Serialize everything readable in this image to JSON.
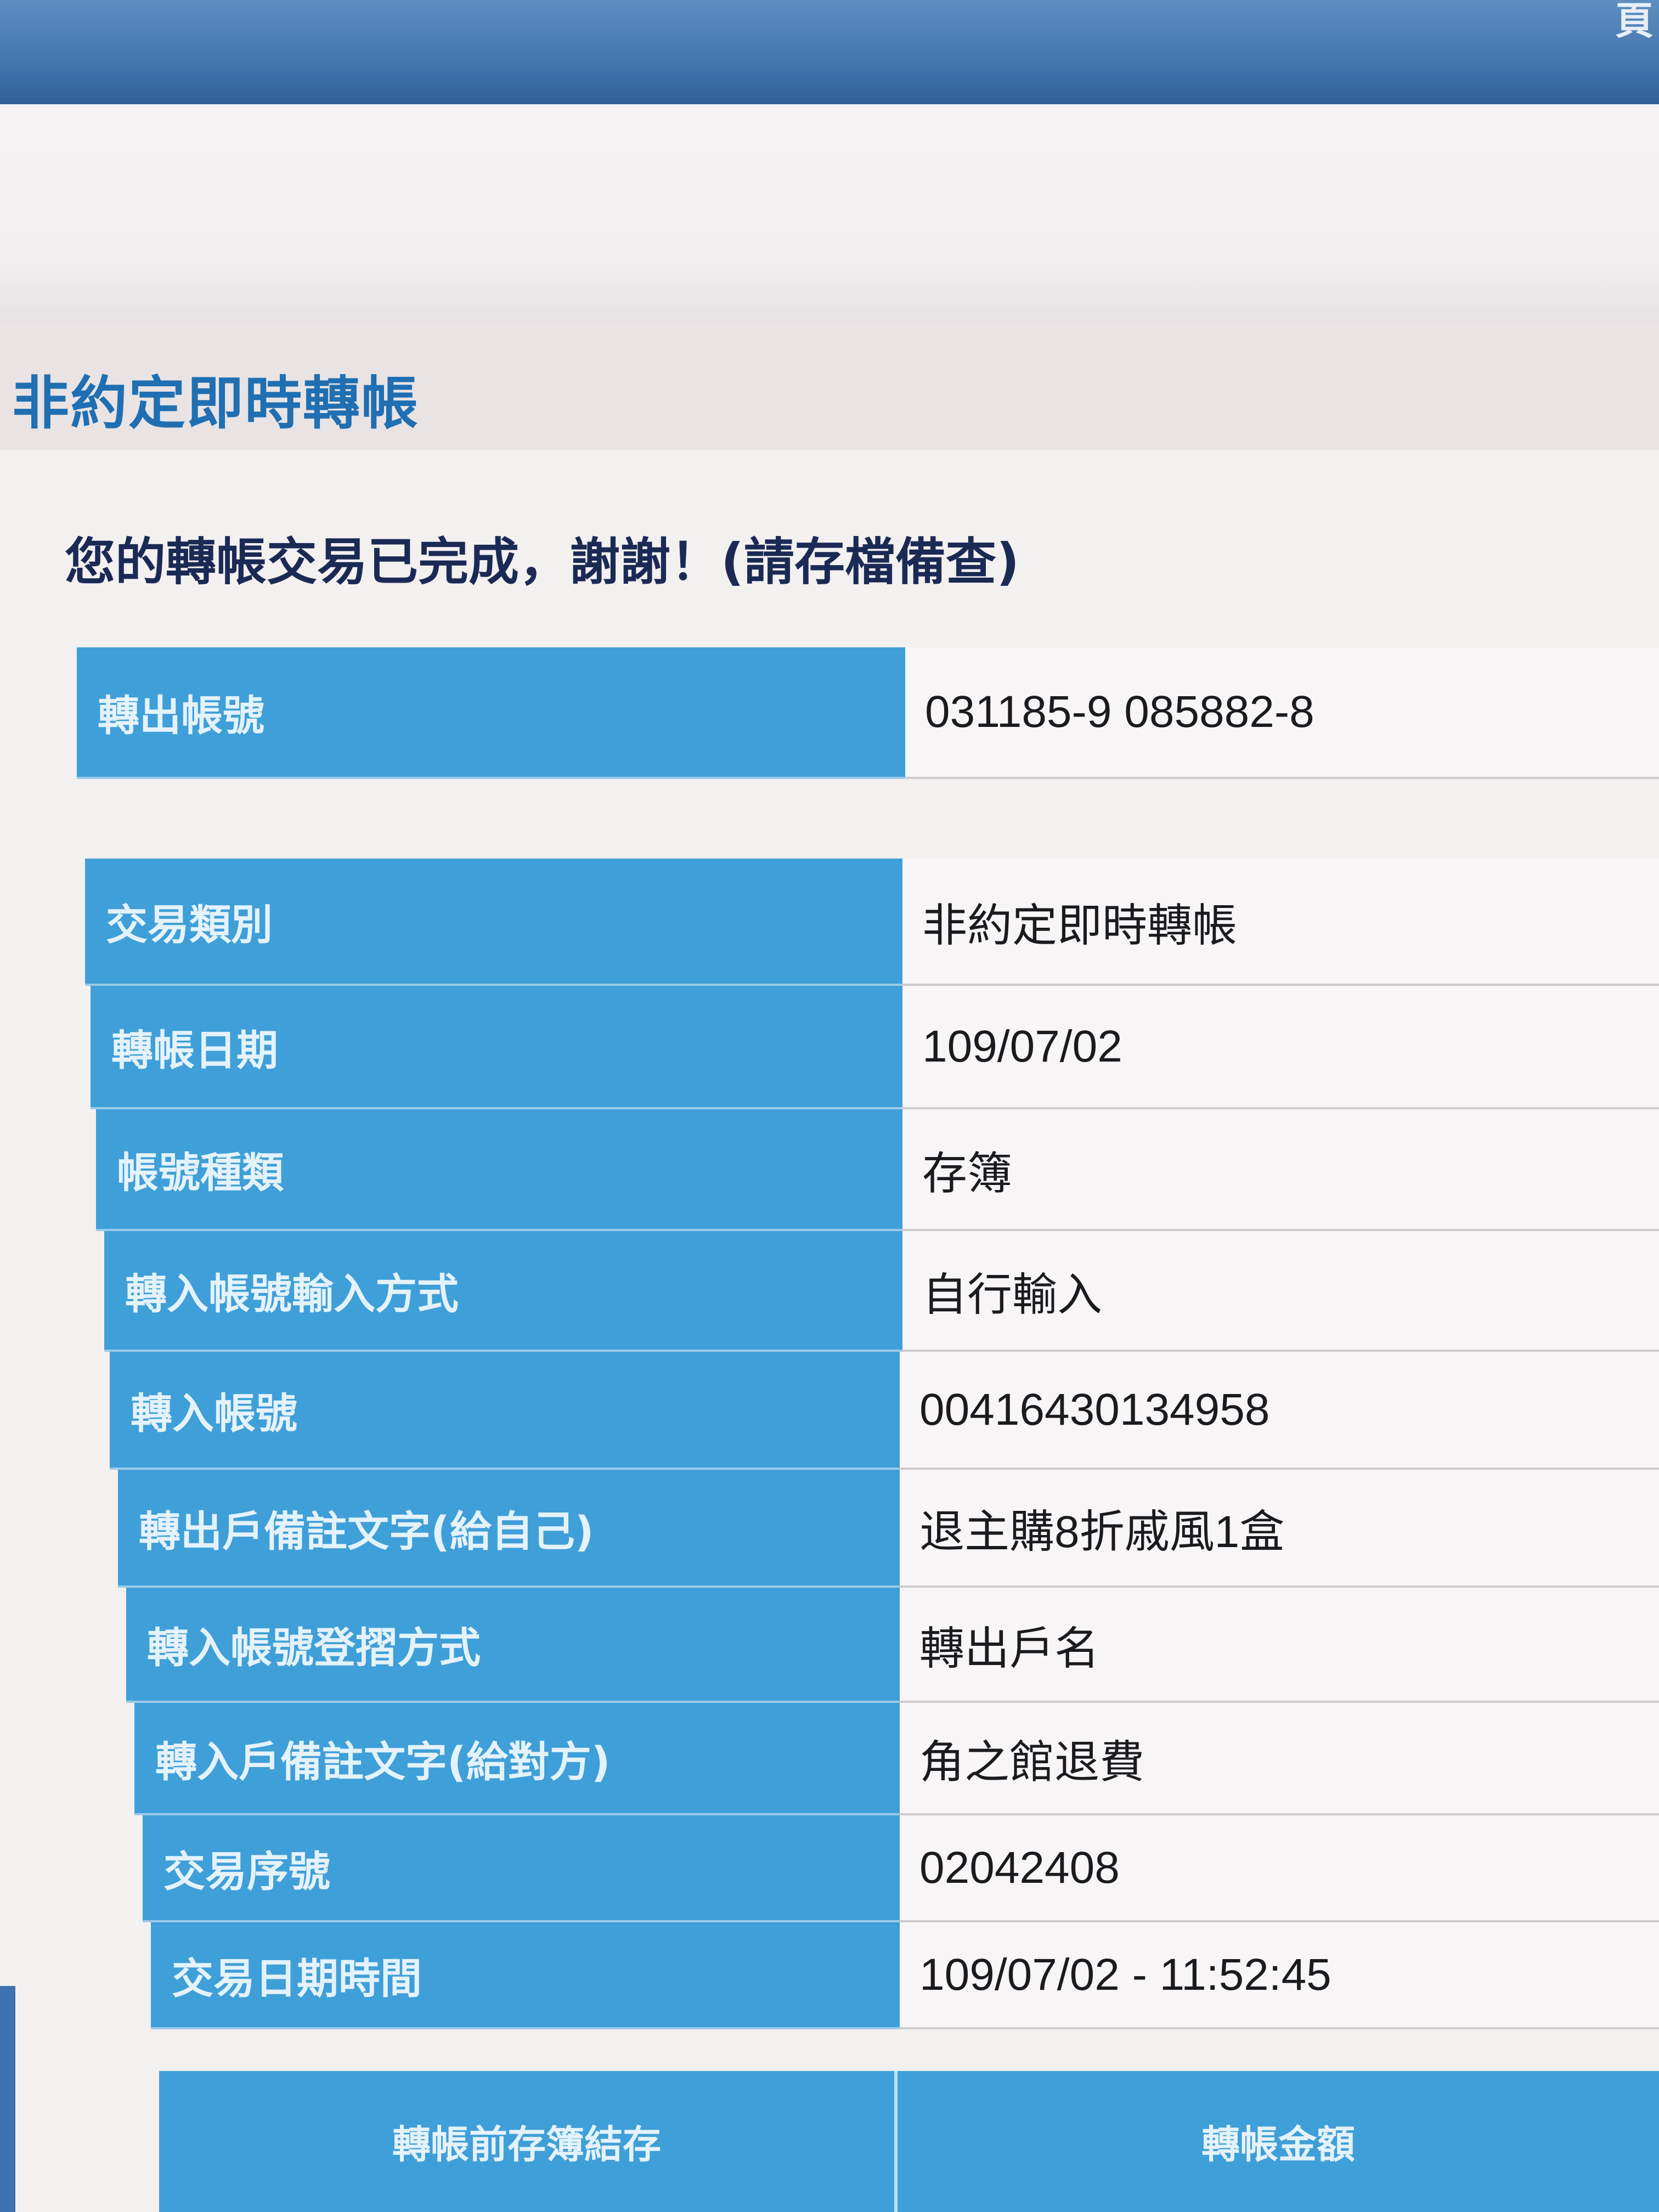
{
  "top_bar": {
    "corner_text": "頁"
  },
  "page_title": "非約定即時轉帳",
  "success_message": "您的轉帳交易已完成，謝謝！(請存檔備查)",
  "source_account": {
    "label": "轉出帳號",
    "value": "031185-9 085882-8"
  },
  "details": [
    {
      "label": "交易類別",
      "value": "非約定即時轉帳"
    },
    {
      "label": "轉帳日期",
      "value": "109/07/02"
    },
    {
      "label": "帳號種類",
      "value": "存簿"
    },
    {
      "label": "轉入帳號輸入方式",
      "value": "自行輸入"
    },
    {
      "label": "轉入帳號",
      "value": "00416430134958"
    },
    {
      "label": "轉出戶備註文字(給自己)",
      "value": "退主購8折戚風1盒"
    },
    {
      "label": "轉入帳號登摺方式",
      "value": "轉出戶名"
    },
    {
      "label": "轉入戶備註文字(給對方)",
      "value": "角之館退費"
    },
    {
      "label": "交易序號",
      "value": "02042408"
    },
    {
      "label": "交易日期時間",
      "value": "109/07/02 - 11:52:45"
    }
  ],
  "bottom_table": {
    "headers": [
      "轉帳前存簿結存",
      "轉帳金額"
    ]
  },
  "colors": {
    "top_bar": "#3e72aa",
    "title": "#1f6fb2",
    "label_bg": "#3f9fd8",
    "value_bg": "#f7f5f6",
    "message": "#1b2a55"
  }
}
